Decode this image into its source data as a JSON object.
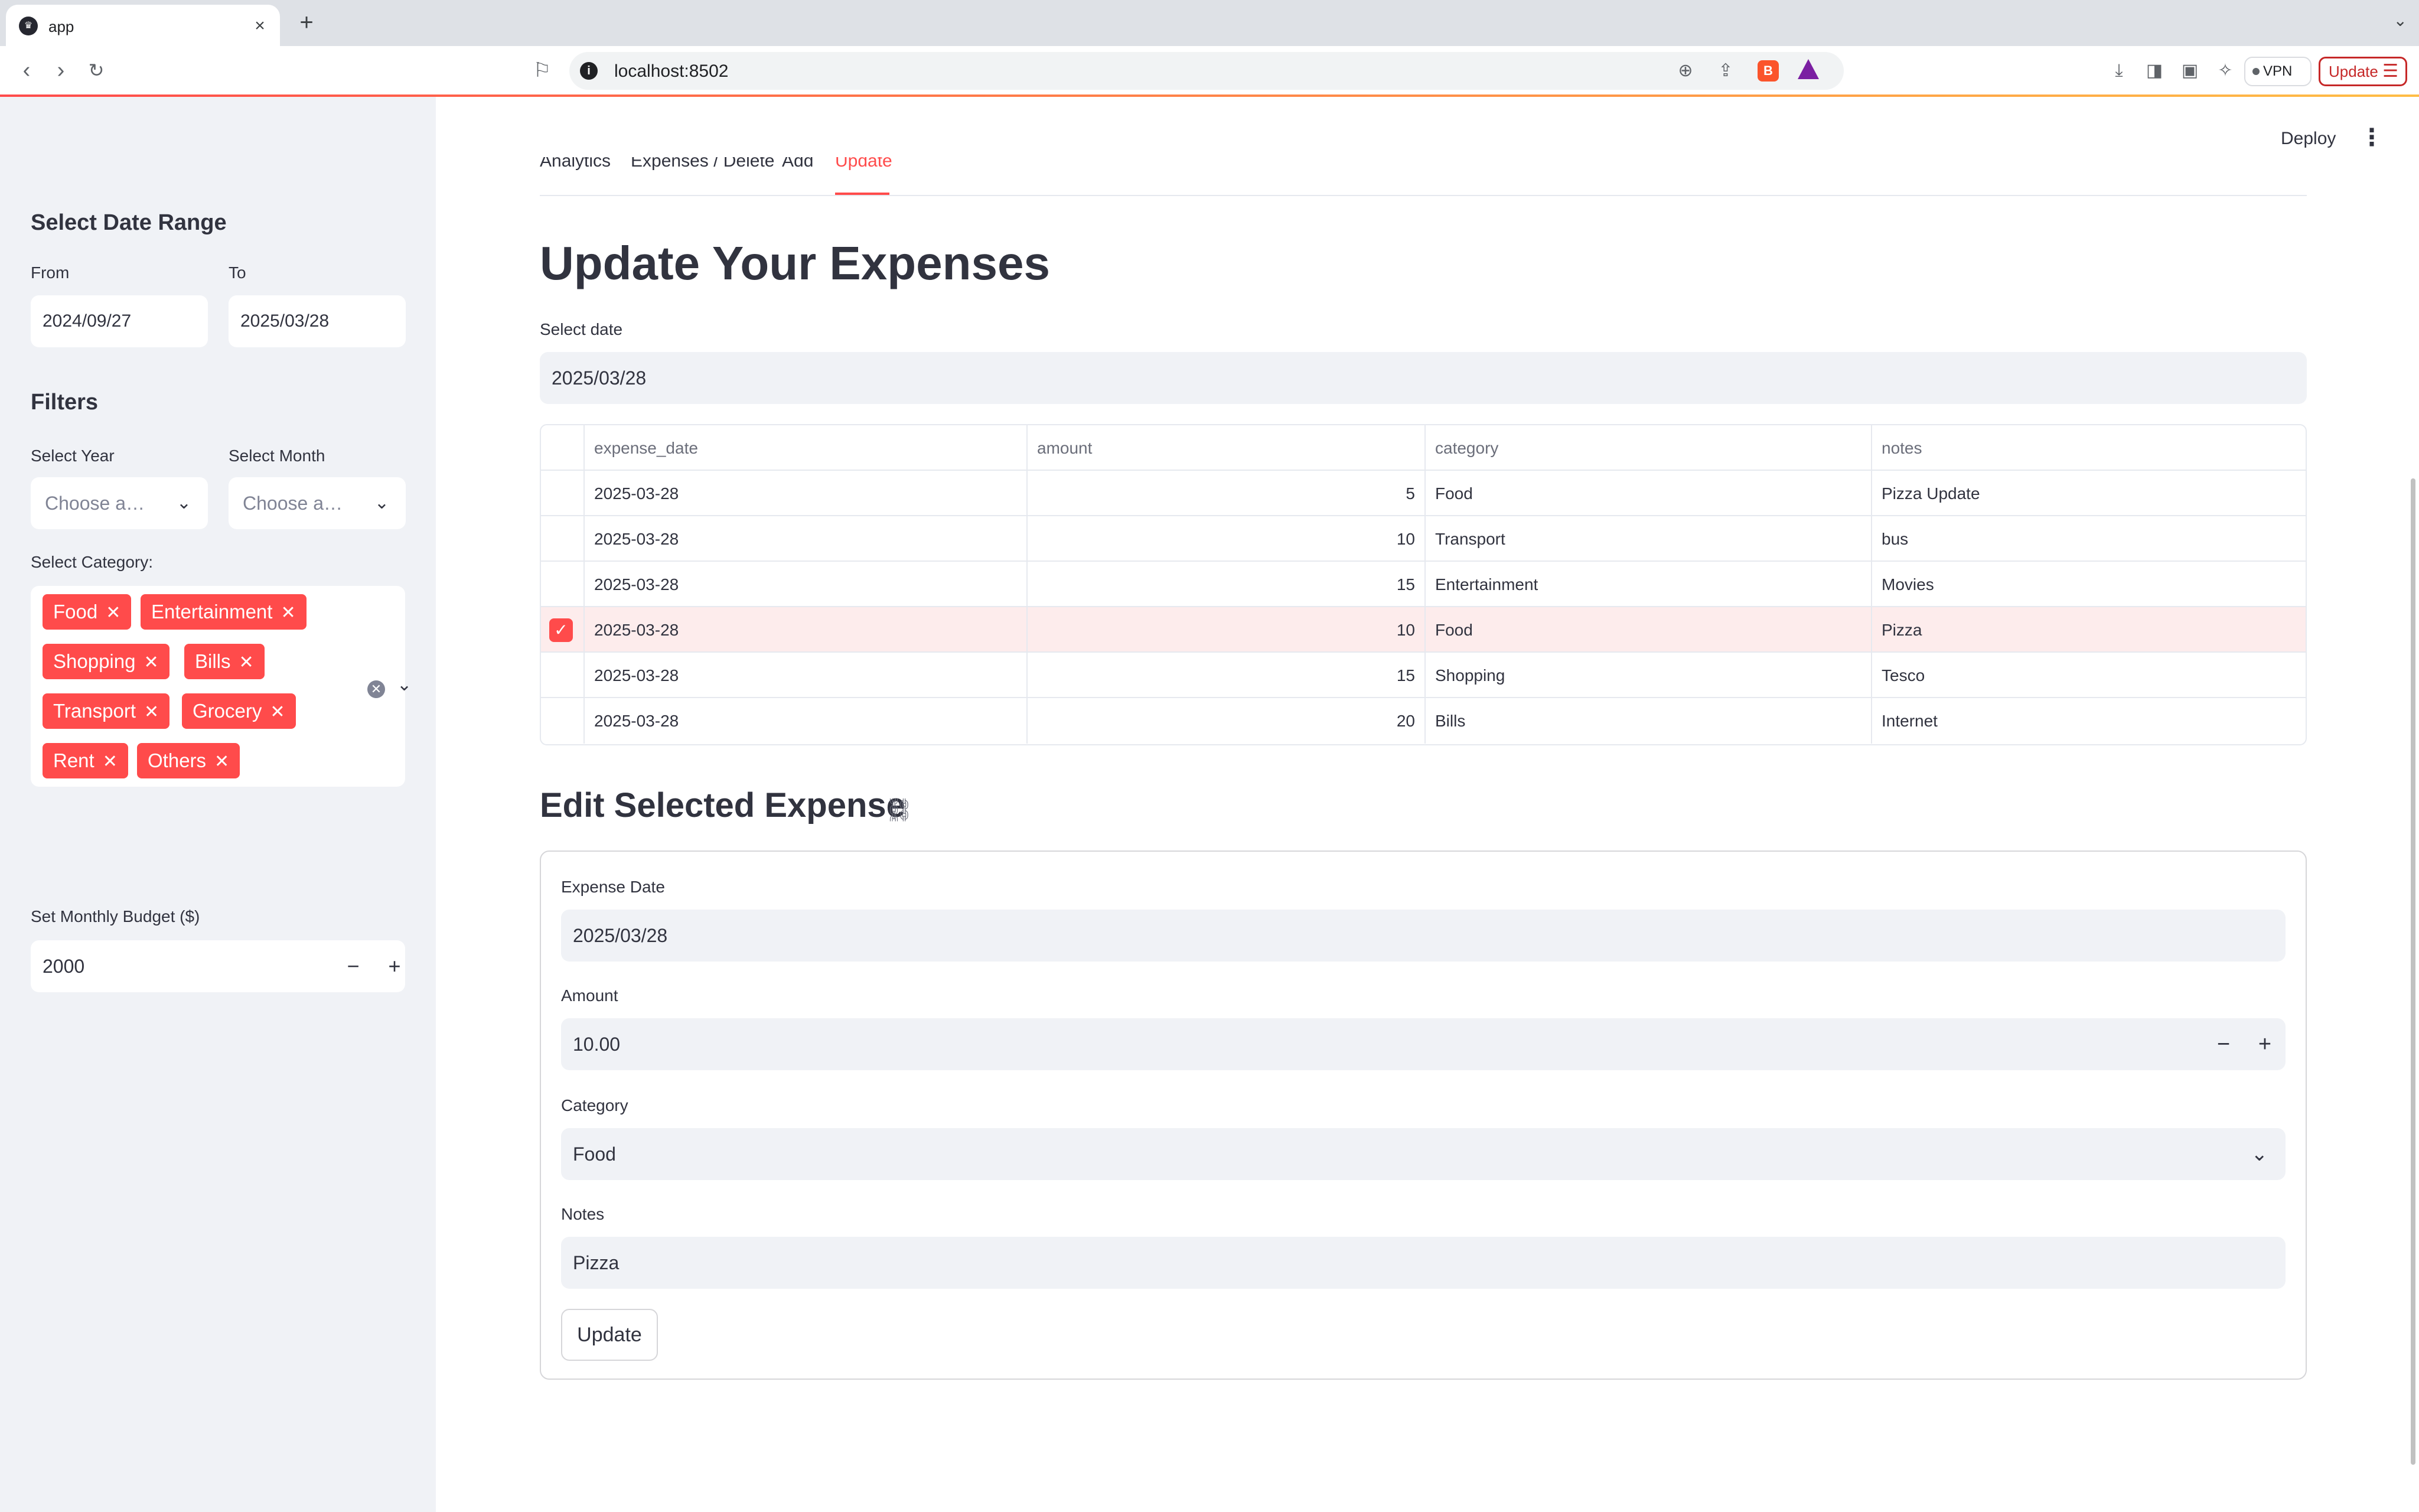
{
  "browser": {
    "tab_title": "app",
    "new_tab": "+",
    "close": "×",
    "url": "localhost:8502",
    "vpn_label": "VPN",
    "update_label": "Update"
  },
  "header": {
    "deploy_label": "Deploy"
  },
  "tabs": [
    {
      "label": "Analytics"
    },
    {
      "label": "Expenses / Delete"
    },
    {
      "label": "Add"
    },
    {
      "label": "Update"
    }
  ],
  "sidebar": {
    "date_range_title": "Select Date Range",
    "from_label": "From",
    "from_value": "2024/09/27",
    "to_label": "To",
    "to_value": "2025/03/28",
    "filters_title": "Filters",
    "year_label": "Select Year",
    "year_placeholder": "Choose a…",
    "month_label": "Select Month",
    "month_placeholder": "Choose a…",
    "category_label": "Select Category:",
    "categories": [
      "Food",
      "Entertainment",
      "Shopping",
      "Bills",
      "Transport",
      "Grocery",
      "Rent",
      "Others"
    ],
    "budget_label": "Set Monthly Budget ($)",
    "budget_value": "2000"
  },
  "main": {
    "title": "Update Your Expenses",
    "select_date_label": "Select date",
    "select_date_value": "2025/03/28",
    "table": {
      "columns": [
        "expense_date",
        "amount",
        "category",
        "notes"
      ],
      "rows": [
        {
          "expense_date": "2025-03-28",
          "amount": "5",
          "category": "Food",
          "notes": "Pizza Update",
          "selected": false
        },
        {
          "expense_date": "2025-03-28",
          "amount": "10",
          "category": "Transport",
          "notes": "bus",
          "selected": false
        },
        {
          "expense_date": "2025-03-28",
          "amount": "15",
          "category": "Entertainment",
          "notes": "Movies",
          "selected": false
        },
        {
          "expense_date": "2025-03-28",
          "amount": "10",
          "category": "Food",
          "notes": "Pizza",
          "selected": true
        },
        {
          "expense_date": "2025-03-28",
          "amount": "15",
          "category": "Shopping",
          "notes": "Tesco",
          "selected": false
        },
        {
          "expense_date": "2025-03-28",
          "amount": "20",
          "category": "Bills",
          "notes": "Internet",
          "selected": false
        }
      ]
    },
    "edit_title": "Edit Selected Expense",
    "form": {
      "date_label": "Expense Date",
      "date_value": "2025/03/28",
      "amount_label": "Amount",
      "amount_value": "10.00",
      "category_label": "Category",
      "category_value": "Food",
      "notes_label": "Notes",
      "notes_value": "Pizza",
      "submit_label": "Update"
    }
  },
  "colors": {
    "accent": "#ff4b4b",
    "sidebar_bg": "#f0f2f6",
    "text": "#31333f"
  }
}
